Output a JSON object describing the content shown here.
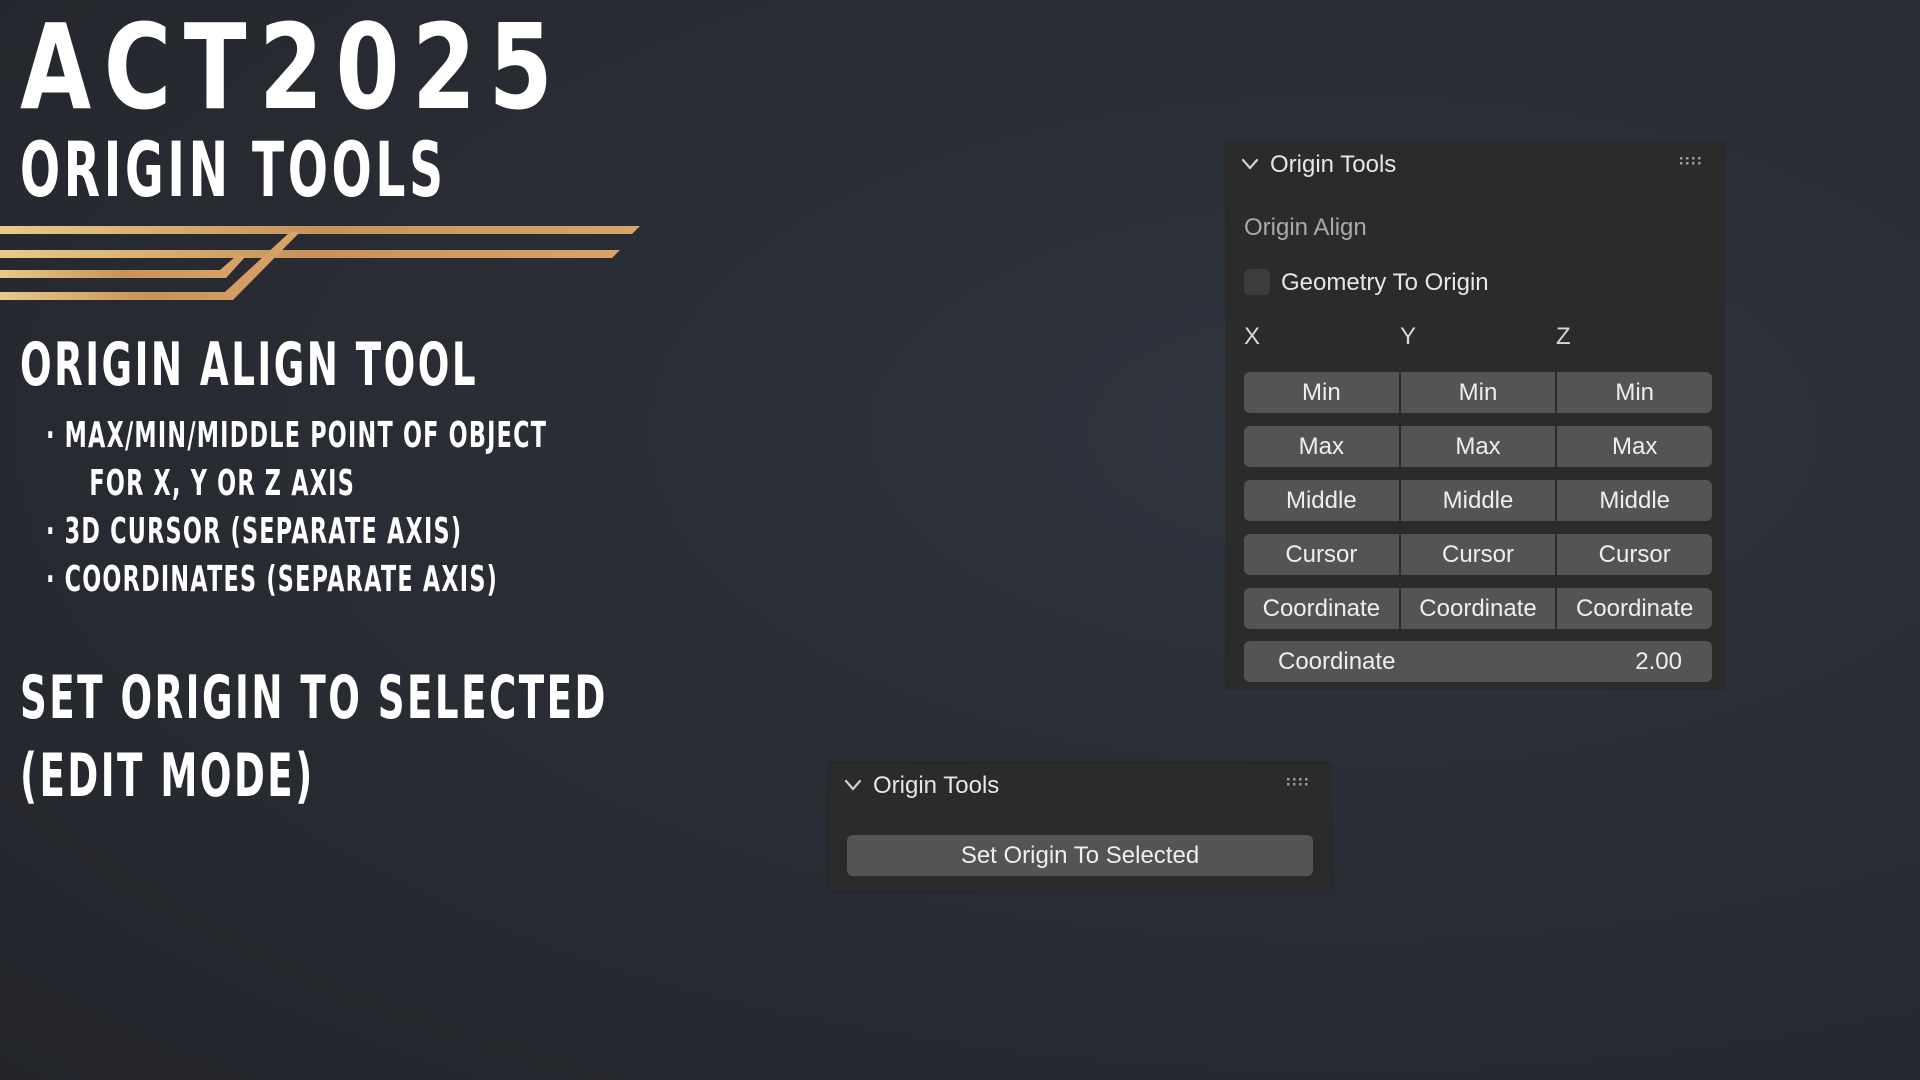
{
  "promo": {
    "title": "ACT2025",
    "subtitle": "ORIGIN TOOLS",
    "section1_heading": "ORIGIN ALIGN TOOL",
    "bullets": [
      {
        "dot": "·",
        "line1": "MAX/MIN/MIDDLE POINT OF OBJECT",
        "line2": "FOR X, Y OR Z AXIS"
      },
      {
        "dot": "·",
        "line1": "3D CURSOR (SEPARATE AXIS)"
      },
      {
        "dot": "·",
        "line1": "COORDINATES (SEPARATE AXIS)"
      }
    ],
    "section2_heading_line1": "SET ORIGIN TO SELECTED",
    "section2_heading_line2": "(EDIT MODE)",
    "accent_colors": [
      "#c8925a",
      "#e8c98c",
      "#b9834e"
    ]
  },
  "panel_main": {
    "title": "Origin Tools",
    "sub_label": "Origin Align",
    "checkbox_label": "Geometry To Origin",
    "checkbox_checked": false,
    "axes": [
      "X",
      "Y",
      "Z"
    ],
    "rows": [
      [
        "Min",
        "Min",
        "Min"
      ],
      [
        "Max",
        "Max",
        "Max"
      ],
      [
        "Middle",
        "Middle",
        "Middle"
      ],
      [
        "Cursor",
        "Cursor",
        "Cursor"
      ],
      [
        "Coordinate",
        "Coordinate",
        "Coordinate"
      ]
    ],
    "field": {
      "label": "Coordinate",
      "value": "2.00"
    },
    "icons": {
      "collapse": "chevron-down-icon",
      "drag": "grip-dots-icon"
    }
  },
  "panel_small": {
    "title": "Origin Tools",
    "button_label": "Set Origin To Selected",
    "icons": {
      "collapse": "chevron-down-icon",
      "drag": "grip-dots-icon"
    }
  }
}
